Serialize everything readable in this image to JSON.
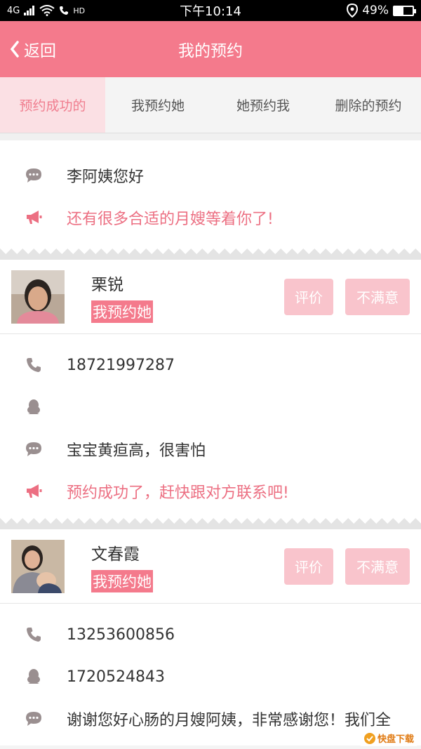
{
  "status_bar": {
    "network": "4G",
    "hd": "HD",
    "time": "下午10:14",
    "battery": "49%",
    "battery_level": 0.49
  },
  "header": {
    "back_label": "返回",
    "title": "我的预约"
  },
  "tabs": [
    {
      "label": "预约成功的",
      "active": true
    },
    {
      "label": "我预约她"
    },
    {
      "label": "她预约我"
    },
    {
      "label": "删除的预约"
    }
  ],
  "intro": {
    "greeting": "李阿姨您好",
    "notice": "还有很多合适的月嫂等着你了!"
  },
  "appointments": [
    {
      "name": "栗锐",
      "tag": "我预约她",
      "rate_label": "评价",
      "unsatisfied_label": "不满意",
      "phone": "18721997287",
      "qq": "",
      "message": "宝宝黄疸高，很害怕",
      "notice": "预约成功了，赶快跟对方联系吧!"
    },
    {
      "name": "文春霞",
      "tag": "我预约她",
      "rate_label": "评价",
      "unsatisfied_label": "不满意",
      "phone": "13253600856",
      "qq": "1720524843",
      "message": "谢谢您好心肠的月嫂阿姨，非常感谢您！我们全"
    }
  ],
  "watermark": "快盘下载",
  "colors": {
    "accent": "#f47a8c",
    "button": "#f9c4cc",
    "notice_text": "#ec6f82",
    "tab_active_bg": "#fbe0e4"
  }
}
